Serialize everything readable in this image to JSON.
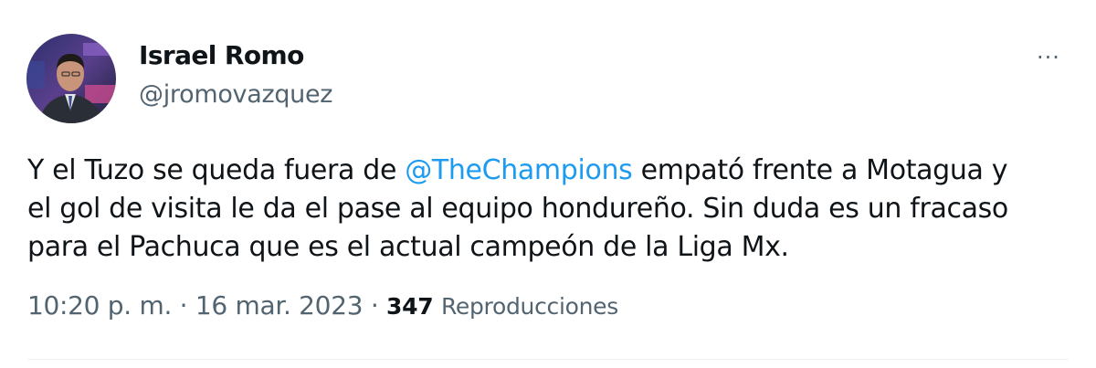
{
  "author": {
    "display_name": "Israel Romo",
    "handle": "@jromovazquez",
    "avatar_icon": "avatar-photo"
  },
  "more_icon": "more-horizontal-icon",
  "more_label": "···",
  "tweet": {
    "line1_before": "Y el Tuzo se queda fuera de ",
    "mention": "@TheChampions",
    "line1_after": " empató frente a Motagua y",
    "line2": "el gol de visita le da el pase al equipo hondureño. Sin duda es un fracaso",
    "line3": "para el Pachuca que es el actual campeón de la Liga Mx."
  },
  "meta": {
    "time": "10:20 p. m.",
    "separator": " · ",
    "date": "16 mar. 2023",
    "views_count": "347",
    "views_label": "Reproducciones"
  },
  "colors": {
    "link": "#1d9bf0",
    "secondary_text": "#536471",
    "primary_text": "#0f1419",
    "divider": "#eff3f4"
  }
}
